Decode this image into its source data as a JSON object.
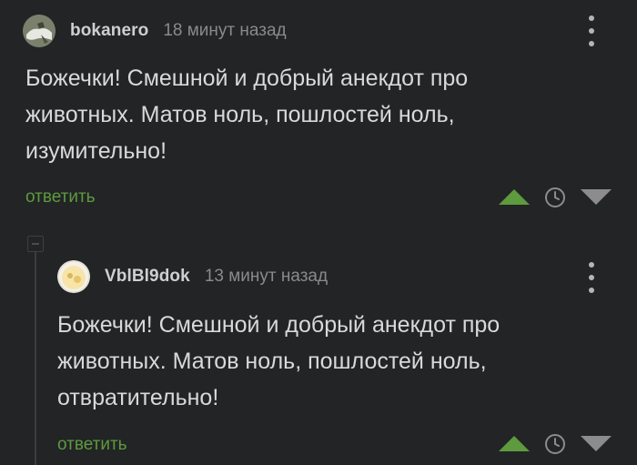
{
  "comments": [
    {
      "username": "bokanero",
      "time": "18 минут назад",
      "text": "Божечки! Смешной и добрый анекдот про\nживотных. Матов ноль, пошлостей ноль,\nизумительно!",
      "reply_label": "ответить"
    },
    {
      "username": "VblBl9dok",
      "time": "13 минут назад",
      "text": "Божечки! Смешной и добрый анекдот про\nживотных. Матов ноль, пошлостей ноль,\nотвратительно!",
      "reply_label": "ответить"
    }
  ],
  "colors": {
    "background": "#222426",
    "accent": "#5e9a3e",
    "downvote": "#8c8c8c"
  },
  "icons": [
    "more-icon",
    "upvote-icon",
    "clock-icon",
    "downvote-icon",
    "collapse-icon"
  ]
}
